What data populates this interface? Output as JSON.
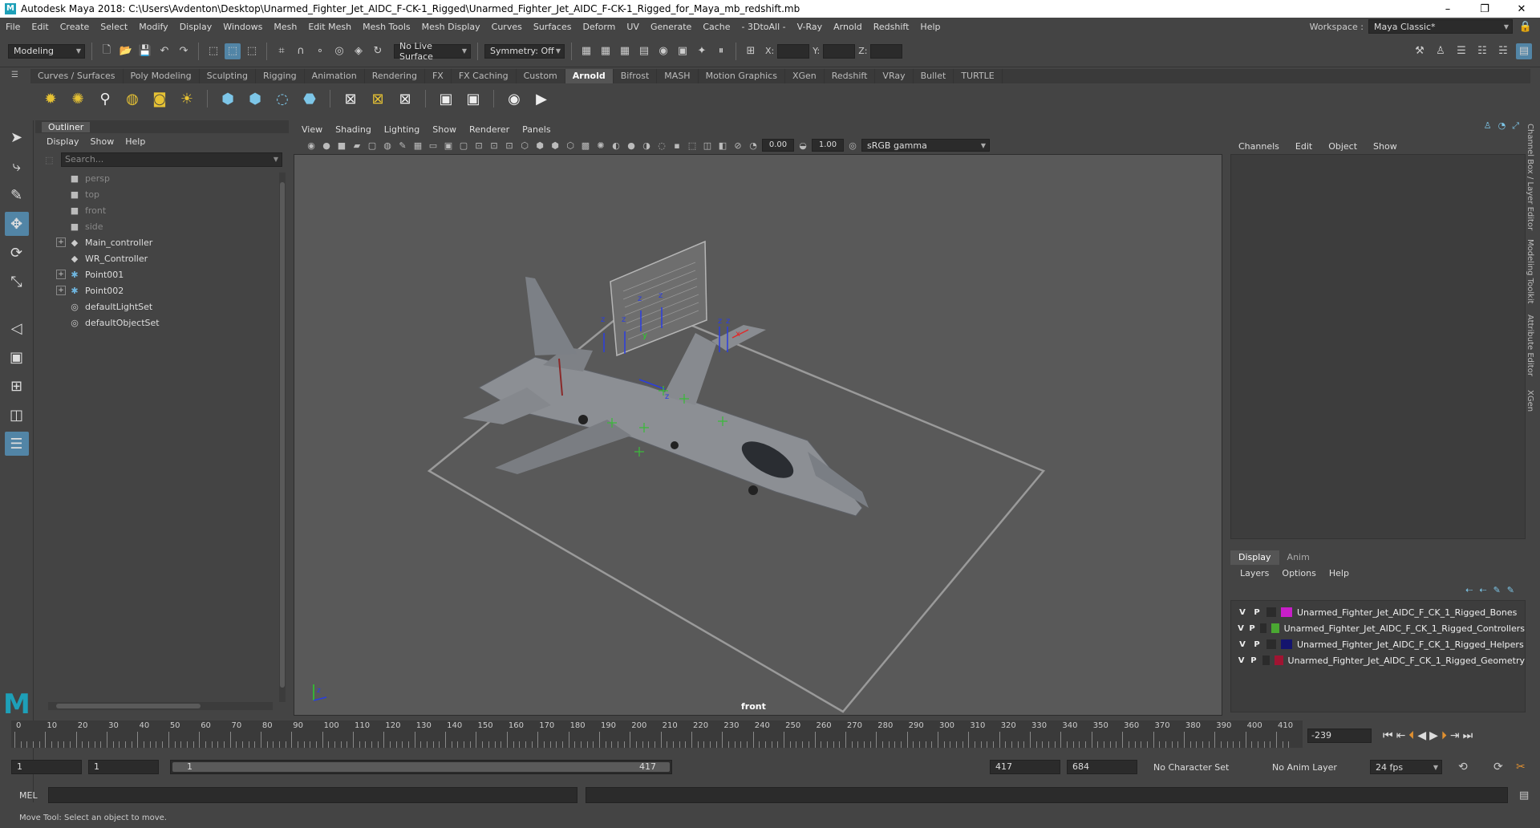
{
  "title_bar": {
    "title": "Autodesk Maya 2018: C:\\Users\\Avdenton\\Desktop\\Unarmed_Fighter_Jet_AIDC_F-CK-1_Rigged\\Unarmed_Fighter_Jet_AIDC_F-CK-1_Rigged_for_Maya_mb_redshift.mb",
    "minimize": "–",
    "maximize": "❐",
    "close": "✕"
  },
  "menubar": {
    "items": [
      "File",
      "Edit",
      "Create",
      "Select",
      "Modify",
      "Display",
      "Windows",
      "Mesh",
      "Edit Mesh",
      "Mesh Tools",
      "Mesh Display",
      "Curves",
      "Surfaces",
      "Deform",
      "UV",
      "Generate",
      "Cache",
      "- 3DtoAll -",
      "V-Ray",
      "Arnold",
      "Redshift",
      "Help"
    ],
    "workspace_label": "Workspace :",
    "workspace_value": "Maya Classic*"
  },
  "status_line": {
    "mode": "Modeling",
    "live_surface": "No Live Surface",
    "symmetry": "Symmetry: Off",
    "x_label": "X:",
    "y_label": "Y:",
    "z_label": "Z:"
  },
  "shelf": {
    "tabs": [
      "Curves / Surfaces",
      "Poly Modeling",
      "Sculpting",
      "Rigging",
      "Animation",
      "Rendering",
      "FX",
      "FX Caching",
      "Custom",
      "Arnold",
      "Bifrost",
      "MASH",
      "Motion Graphics",
      "XGen",
      "Redshift",
      "VRay",
      "Bullet",
      "TURTLE"
    ],
    "active_tab": "Arnold"
  },
  "outliner": {
    "title": "Outliner",
    "menu": [
      "Display",
      "Show",
      "Help"
    ],
    "search_placeholder": "Search...",
    "items": [
      {
        "label": "persp",
        "icon": "camera-icon",
        "expandable": false,
        "dim": true
      },
      {
        "label": "top",
        "icon": "camera-icon",
        "expandable": false,
        "dim": true
      },
      {
        "label": "front",
        "icon": "camera-icon",
        "expandable": false,
        "dim": true
      },
      {
        "label": "side",
        "icon": "camera-icon",
        "expandable": false,
        "dim": true
      },
      {
        "label": "Main_controller",
        "icon": "transform-icon",
        "expandable": true,
        "dim": false
      },
      {
        "label": "WR_Controller",
        "icon": "transform-icon",
        "expandable": false,
        "dim": false
      },
      {
        "label": "Point001",
        "icon": "locator-icon",
        "expandable": true,
        "dim": false
      },
      {
        "label": "Point002",
        "icon": "locator-icon",
        "expandable": true,
        "dim": false
      },
      {
        "label": "defaultLightSet",
        "icon": "set-icon",
        "expandable": false,
        "dim": false
      },
      {
        "label": "defaultObjectSet",
        "icon": "set-icon",
        "expandable": false,
        "dim": false
      }
    ]
  },
  "viewport": {
    "menu": [
      "View",
      "Shading",
      "Lighting",
      "Show",
      "Renderer",
      "Panels"
    ],
    "near_value": "0.00",
    "far_value": "1.00",
    "color_space": "sRGB gamma",
    "camera_label": "front"
  },
  "channel_box": {
    "menu": [
      "Channels",
      "Edit",
      "Object",
      "Show"
    ]
  },
  "layer_editor": {
    "tabs": [
      "Display",
      "Anim"
    ],
    "active_tab": "Display",
    "menu": [
      "Layers",
      "Options",
      "Help"
    ],
    "layers": [
      {
        "v": "V",
        "p": "P",
        "name": "Unarmed_Fighter_Jet_AIDC_F_CK_1_Rigged_Bones",
        "color": "#c81ec8"
      },
      {
        "v": "V",
        "p": "P",
        "name": "Unarmed_Fighter_Jet_AIDC_F_CK_1_Rigged_Controllers",
        "color": "#4aa832"
      },
      {
        "v": "V",
        "p": "P",
        "name": "Unarmed_Fighter_Jet_AIDC_F_CK_1_Rigged_Helpers",
        "color": "#14146e"
      },
      {
        "v": "V",
        "p": "P",
        "name": "Unarmed_Fighter_Jet_AIDC_F_CK_1_Rigged_Geometry",
        "color": "#a01432"
      }
    ]
  },
  "side_tabs": [
    "Channel Box / Layer Editor",
    "Modeling Toolkit",
    "Attribute Editor",
    "XGen"
  ],
  "timeline": {
    "ticks": [
      "0",
      "10",
      "20",
      "30",
      "40",
      "50",
      "60",
      "70",
      "80",
      "90",
      "100",
      "110",
      "120",
      "130",
      "140",
      "150",
      "160",
      "170",
      "180",
      "190",
      "200",
      "210",
      "220",
      "230",
      "240",
      "250",
      "260",
      "270",
      "280",
      "290",
      "300",
      "310",
      "320",
      "330",
      "340",
      "350",
      "360",
      "370",
      "380",
      "390",
      "400",
      "410"
    ],
    "current_frame": "-239"
  },
  "range": {
    "start": "1",
    "anim_start": "1",
    "slider_start": "1",
    "slider_end": "417",
    "end": "417",
    "anim_end": "684",
    "character_set": "No Character Set",
    "anim_layer": "No Anim Layer",
    "fps": "24 fps"
  },
  "command_line": {
    "label": "MEL"
  },
  "help_line": {
    "text": "Move Tool: Select an object to move."
  }
}
